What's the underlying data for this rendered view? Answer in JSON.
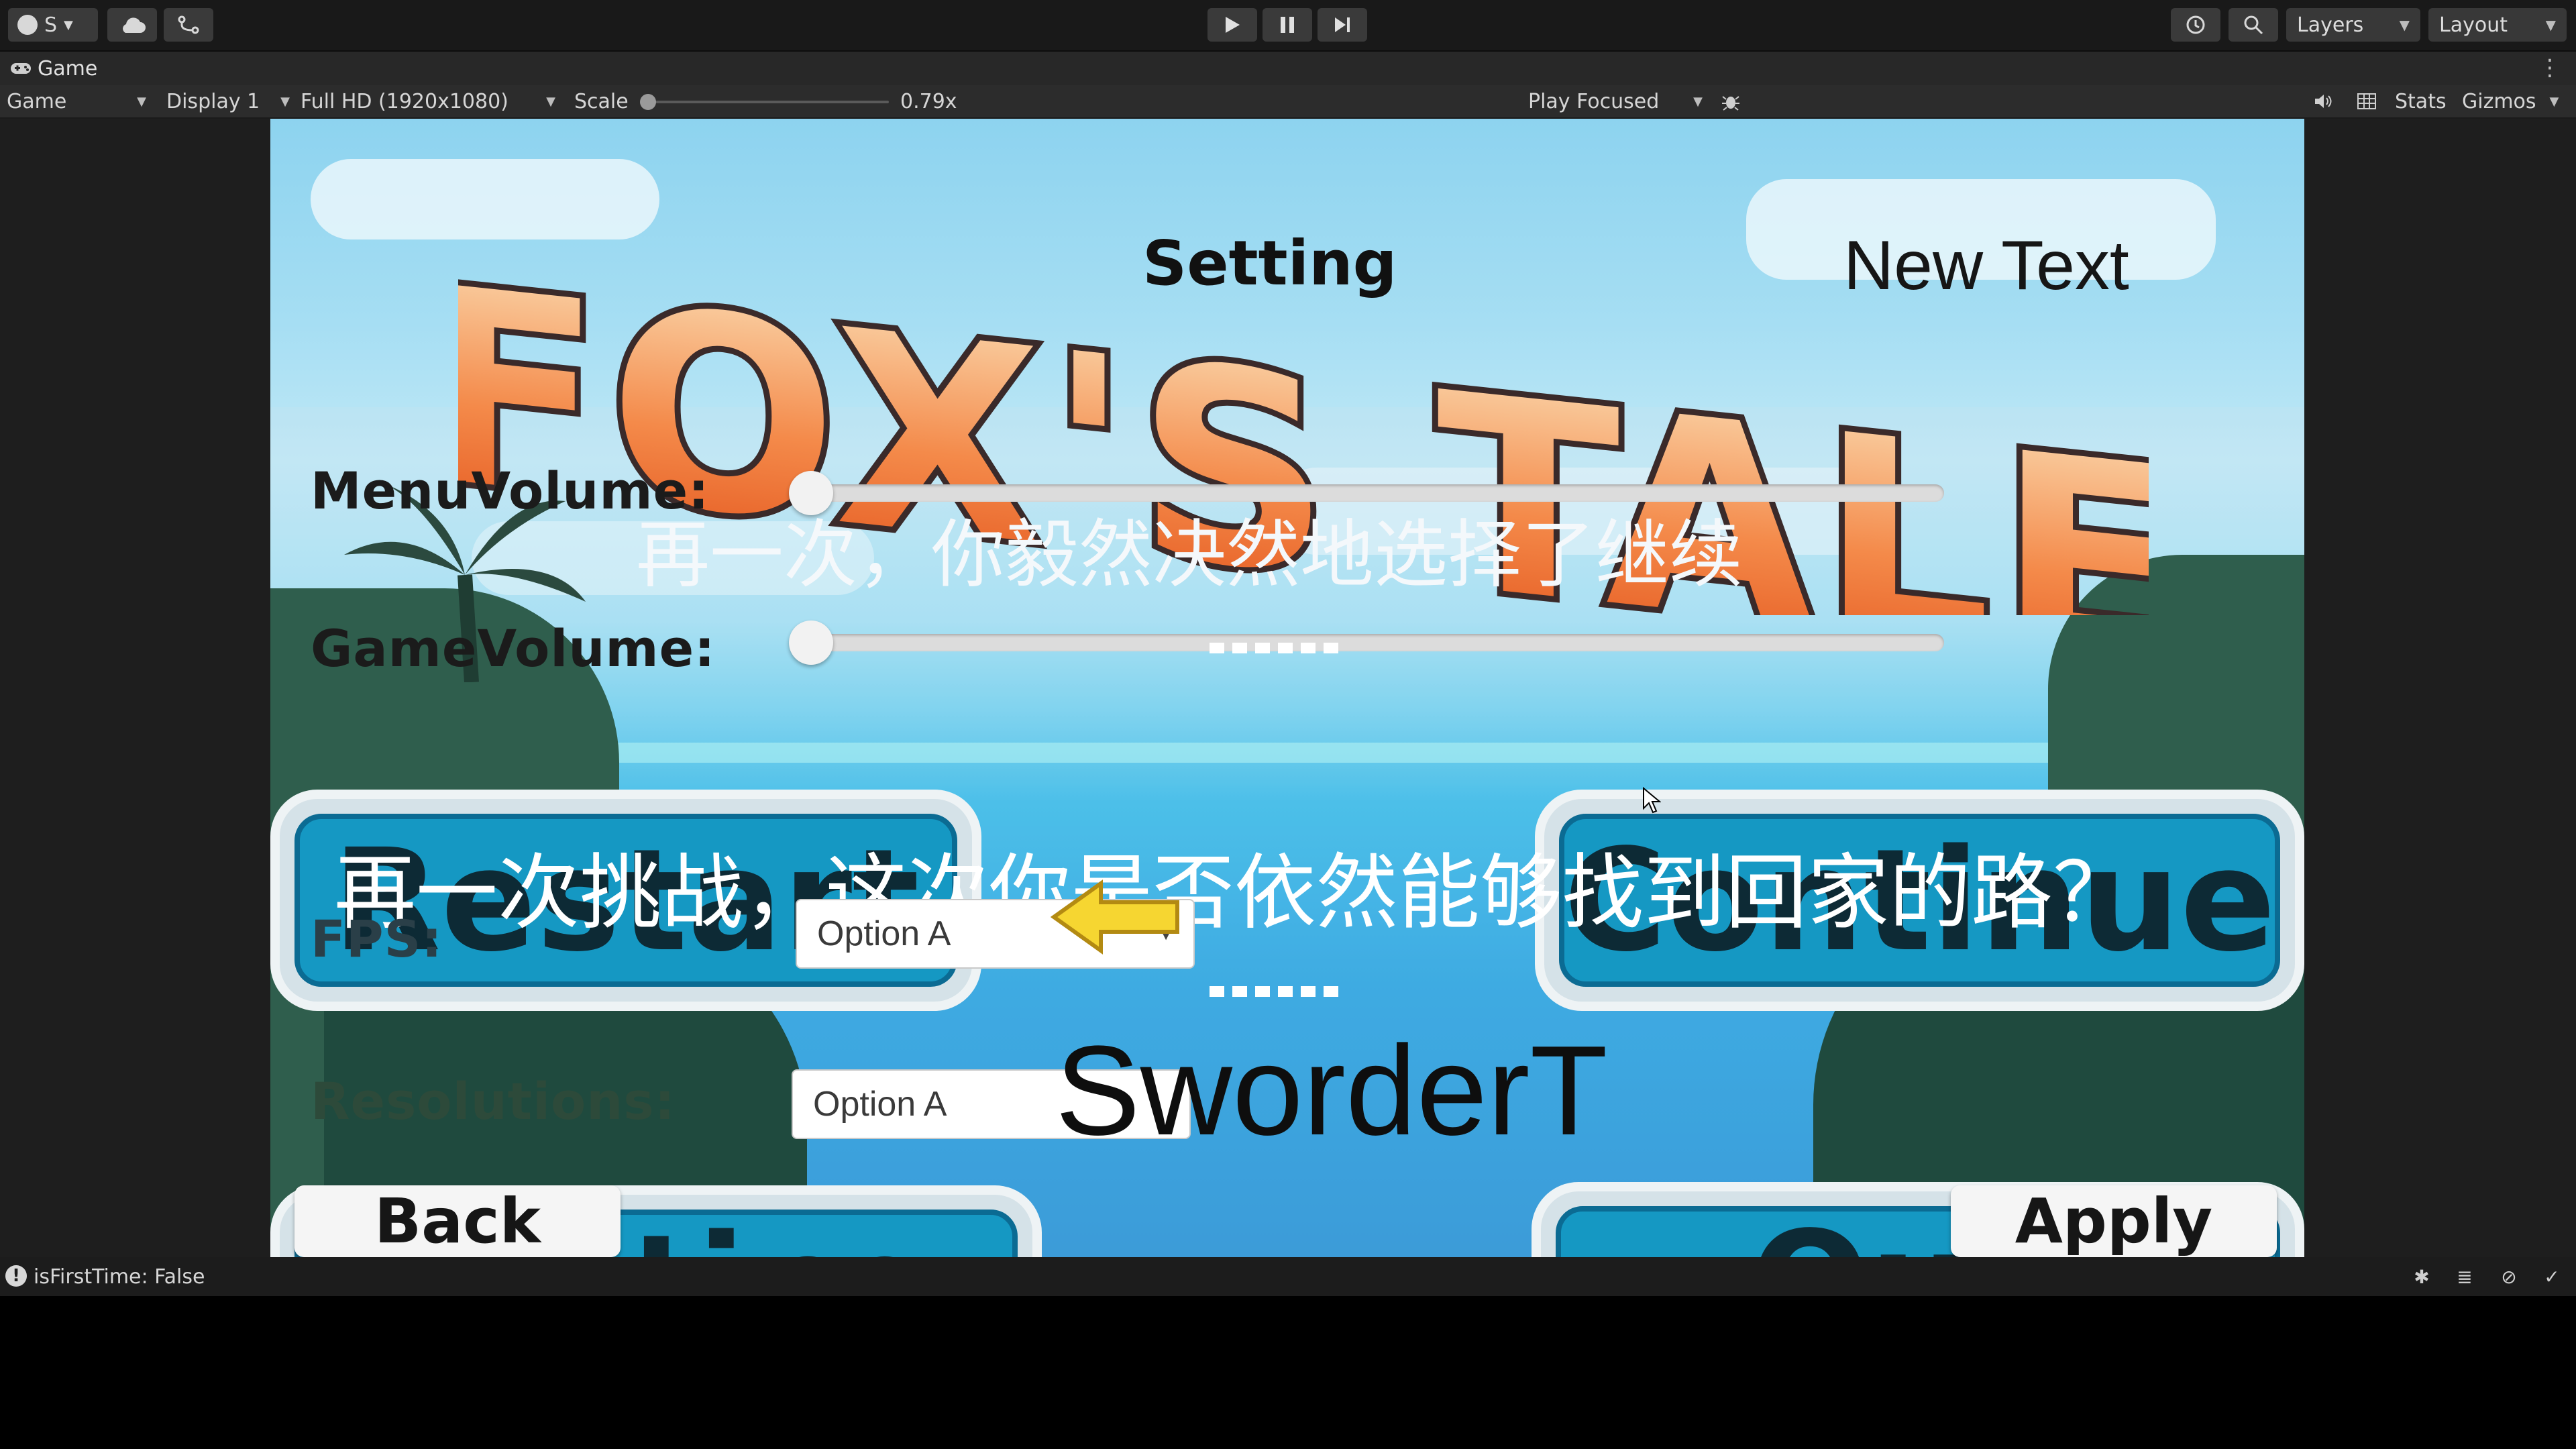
{
  "toolbar": {
    "account_label": "S",
    "layers_label": "Layers",
    "layout_label": "Layout"
  },
  "tab": {
    "title": "Game"
  },
  "controls": {
    "view_mode": "Game",
    "display": "Display 1",
    "resolution": "Full HD (1920x1080)",
    "scale_label": "Scale",
    "scale_value": "0.79x",
    "scale_fraction": 0.0,
    "play_mode": "Play Focused",
    "stats_label": "Stats",
    "gizmos_label": "Gizmos"
  },
  "game": {
    "logo_text": "FOX'S TALE",
    "setting_title": "Setting",
    "new_text": "New Text",
    "menu_volume_label": "MenuVolume:",
    "game_volume_label": "GameVolume:",
    "fps_label": "FPS:",
    "resolutions_label": "Resolutions:",
    "cn_line_1": "再一次，你毅然决然地选择了继续",
    "cn_line_2": "再一次挑战，这次你是否依然能够找到回家的路？",
    "restart_label": "Restart",
    "continue_label": "Continue",
    "setting_button_label": "Setting",
    "quit_label": "Quit",
    "fps_option": "Option A",
    "resolution_option": "Option A",
    "sworder_text": "SworderT",
    "back_label": "Back",
    "apply_label": "Apply",
    "menu_volume_value": 0.0,
    "game_volume_value": 0.0
  },
  "status": {
    "message": "isFirstTime: False"
  }
}
